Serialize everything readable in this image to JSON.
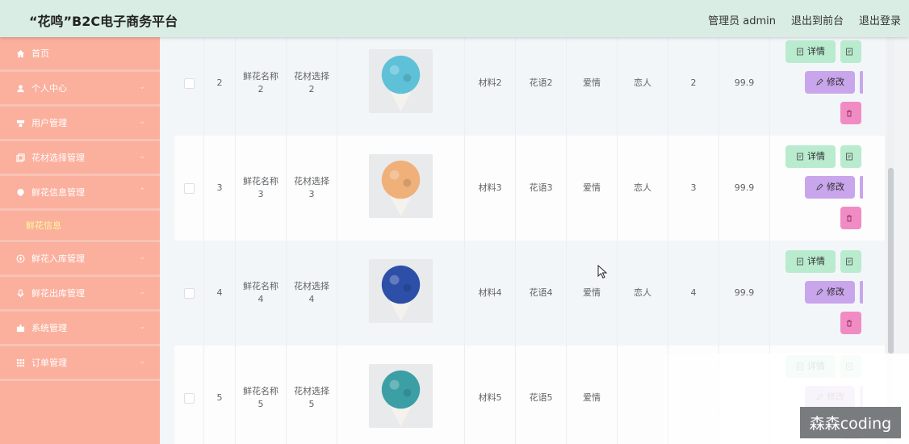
{
  "header": {
    "title": "“花鸣”B2C电子商务平台",
    "admin": "管理员 admin",
    "front": "退出到前台",
    "logout": "退出登录"
  },
  "sidebar": {
    "items": [
      {
        "label": "首页",
        "icon": "home-icon"
      },
      {
        "label": "个人中心",
        "icon": "user-icon"
      },
      {
        "label": "用户管理",
        "icon": "user-manage-icon"
      },
      {
        "label": "花材选择管理",
        "icon": "copy-icon"
      },
      {
        "label": "鲜花信息管理",
        "icon": "flower-icon"
      },
      {
        "label": "鲜花入库管理",
        "icon": "compass-icon"
      },
      {
        "label": "鲜花出库管理",
        "icon": "mic-icon"
      },
      {
        "label": "系统管理",
        "icon": "cog-icon"
      },
      {
        "label": "订单管理",
        "icon": "grid-icon"
      }
    ],
    "active_sub": "鲜花信息"
  },
  "table": {
    "rows": [
      {
        "id": "2",
        "name_a": "鲜花名称",
        "name_b": "2",
        "mat_a": "花材选择",
        "mat_b": "2",
        "material": "材料2",
        "lang": "花语2",
        "type": "爱情",
        "target": "恋人",
        "stock": "2",
        "price": "99.9",
        "img_color": "#5ec1d7"
      },
      {
        "id": "3",
        "name_a": "鲜花名称",
        "name_b": "3",
        "mat_a": "花材选择",
        "mat_b": "3",
        "material": "材料3",
        "lang": "花语3",
        "type": "爱情",
        "target": "恋人",
        "stock": "3",
        "price": "99.9",
        "img_color": "#efb07a"
      },
      {
        "id": "4",
        "name_a": "鲜花名称",
        "name_b": "4",
        "mat_a": "花材选择",
        "mat_b": "4",
        "material": "材料4",
        "lang": "花语4",
        "type": "爱情",
        "target": "恋人",
        "stock": "4",
        "price": "99.9",
        "img_color": "#2d4fa8"
      },
      {
        "id": "5",
        "name_a": "鲜花名称",
        "name_b": "5",
        "mat_a": "花材选择",
        "mat_b": "5",
        "material": "材料5",
        "lang": "花语5",
        "type": "爱情",
        "target": "",
        "stock": "",
        "price": "",
        "img_color": "#3d9fa6"
      }
    ],
    "btn_detail": "详情",
    "btn_edit": "修改"
  },
  "watermark": "森森coding"
}
